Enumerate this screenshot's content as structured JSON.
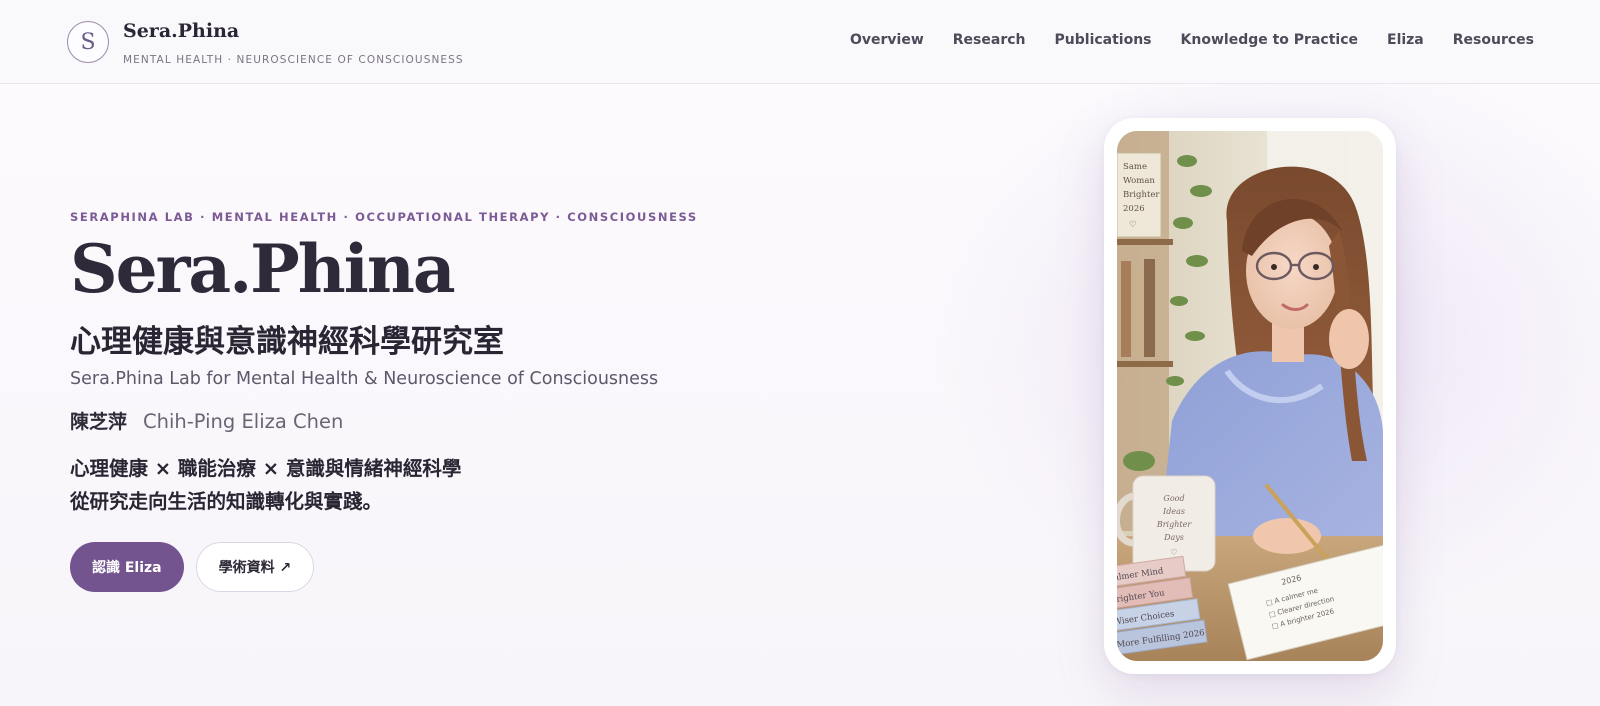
{
  "header": {
    "logo_letter": "S",
    "brand_name": "Sera.Phina",
    "brand_sub": "MENTAL HEALTH · NEUROSCIENCE OF CONSCIOUSNESS",
    "nav": [
      {
        "label": "Overview"
      },
      {
        "label": "Research"
      },
      {
        "label": "Publications"
      },
      {
        "label": "Knowledge to Practice"
      },
      {
        "label": "Eliza"
      },
      {
        "label": "Resources"
      }
    ]
  },
  "hero": {
    "eyebrow": "SERAPHINA LAB · MENTAL HEALTH · OCCUPATIONAL THERAPY · CONSCIOUSNESS",
    "title": "Sera.Phina",
    "zh_title": "心理健康與意識神經科學研究室",
    "en_subtitle": "Sera.Phina Lab for Mental Health & Neuroscience of Consciousness",
    "author_zh": "陳芝萍",
    "author_en": "Chih-Ping Eliza Chen",
    "tagline_line1": "心理健康 × 職能治療 × 意識與情緒神經科學",
    "tagline_line2": "從研究走向生活的知識轉化與實踐。",
    "cta_primary": "認識 Eliza",
    "cta_secondary": "學術資料 ↗"
  },
  "photo": {
    "shelf_note": [
      "Same",
      "Woman",
      "Brighter",
      "2026",
      "♡"
    ],
    "mug_text": [
      "Good",
      "Ideas",
      "Brighter",
      "Days",
      "♡"
    ],
    "notebook_year": "2026",
    "notebook_items": [
      "□ A calmer me",
      "□ Clearer direction",
      "□ A brighter 2026"
    ],
    "books": [
      "Calmer Mind",
      "Brighter You",
      "Wiser Choices",
      "More Fulfilling 2026"
    ]
  },
  "colors": {
    "accent": "#73548f",
    "eyebrow": "#7b5a95",
    "text": "#2f2a38"
  }
}
